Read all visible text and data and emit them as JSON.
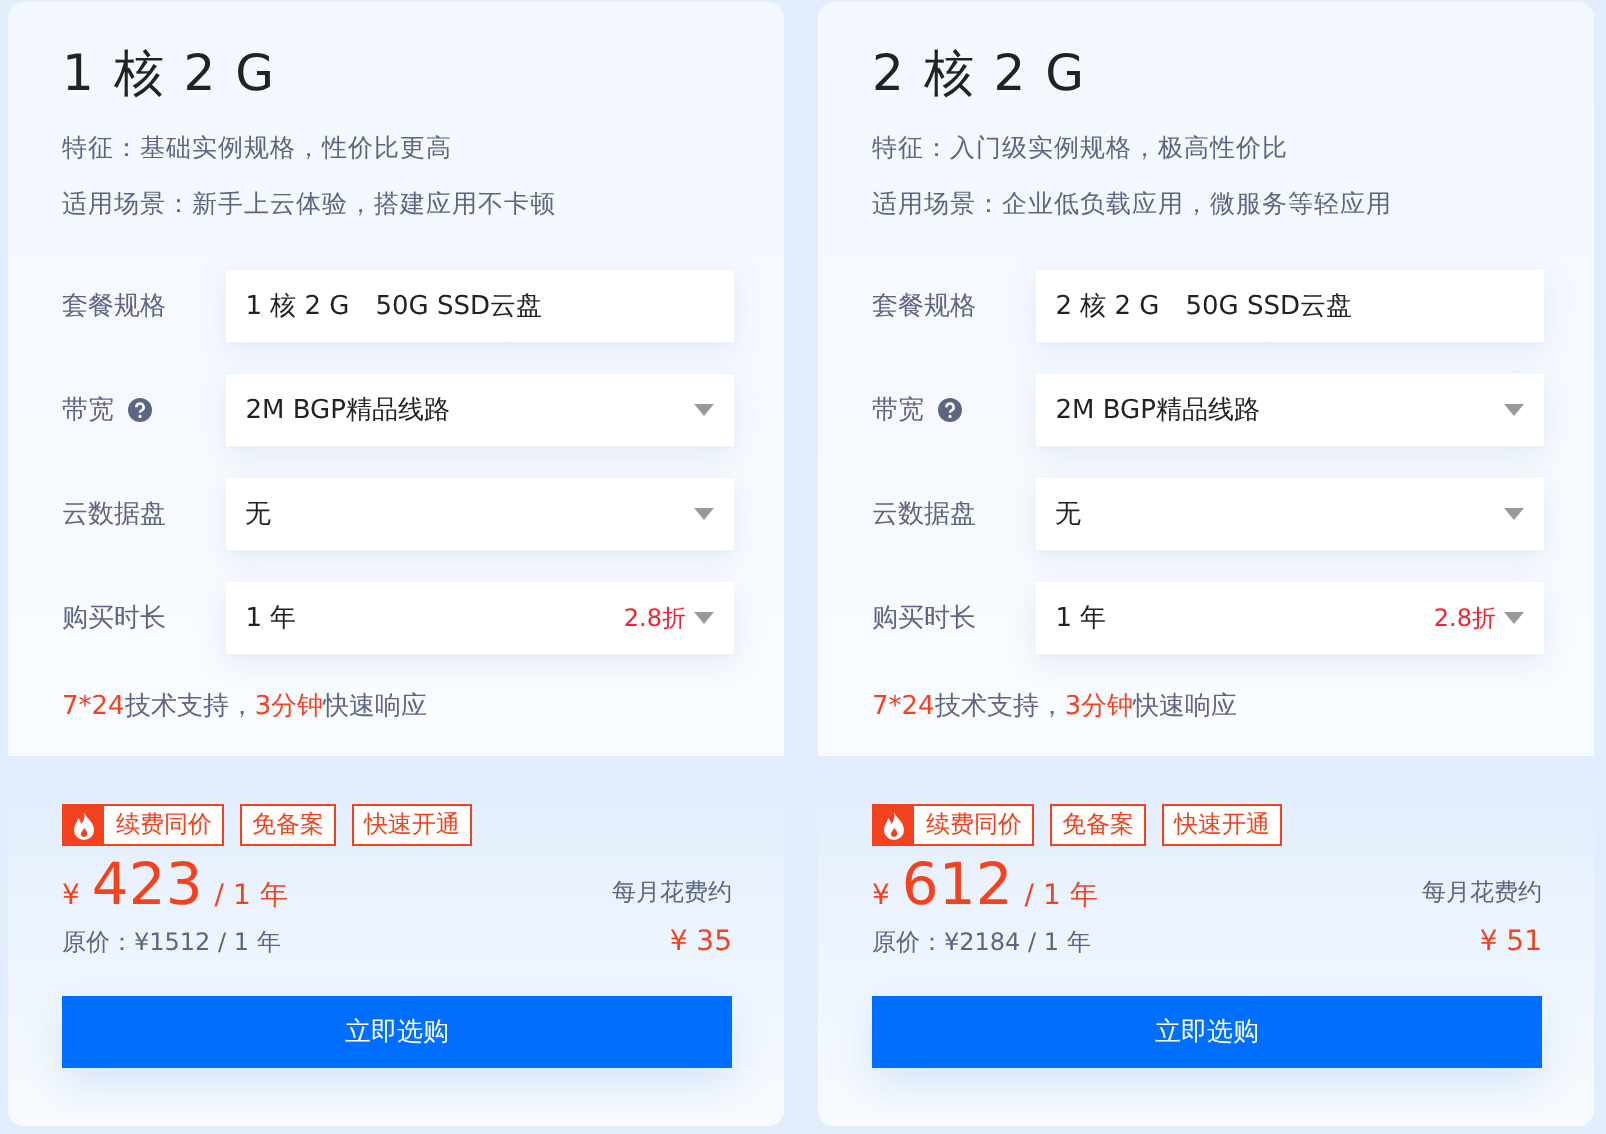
{
  "cards": [
    {
      "title": "1 核 2 G",
      "features": [
        "特征：基础实例规格，性价比更高",
        "适用场景：新手上云体验，搭建应用不卡顿"
      ],
      "options": [
        {
          "label": "套餐规格",
          "kind": "text",
          "help": false,
          "value": "1 核 2 G　50G SSD云盘"
        },
        {
          "label": "带宽",
          "kind": "select",
          "help": true,
          "value": "2M BGP精品线路"
        },
        {
          "label": "云数据盘",
          "kind": "select",
          "help": false,
          "value": "无"
        },
        {
          "label": "购买时长",
          "kind": "select",
          "help": false,
          "value": "1 年",
          "discount": "2.8折"
        }
      ],
      "support": [
        {
          "text": "7*24",
          "highlight": true
        },
        {
          "text": "技术支持，",
          "highlight": false
        },
        {
          "text": "3分钟",
          "highlight": true
        },
        {
          "text": "快速响应",
          "highlight": false
        }
      ],
      "tags": [
        {
          "kind": "hot",
          "label": "续费同价"
        },
        {
          "kind": "plain",
          "label": "免备案"
        },
        {
          "kind": "plain",
          "label": "快速开通"
        }
      ],
      "price": {
        "currency": "¥",
        "amount": "423",
        "period": "/ 1 年"
      },
      "original_price": "原价：¥1512 / 1 年",
      "monthly_label": "每月花费约",
      "monthly": "¥ 35",
      "button": "立即选购"
    },
    {
      "title": "2 核 2 G",
      "features": [
        "特征：入门级实例规格，极高性价比",
        "适用场景：企业低负载应用，微服务等轻应用"
      ],
      "options": [
        {
          "label": "套餐规格",
          "kind": "text",
          "help": false,
          "value": "2 核 2 G　50G SSD云盘"
        },
        {
          "label": "带宽",
          "kind": "select",
          "help": true,
          "value": "2M BGP精品线路"
        },
        {
          "label": "云数据盘",
          "kind": "select",
          "help": false,
          "value": "无"
        },
        {
          "label": "购买时长",
          "kind": "select",
          "help": false,
          "value": "1 年",
          "discount": "2.8折"
        }
      ],
      "support": [
        {
          "text": "7*24",
          "highlight": true
        },
        {
          "text": "技术支持，",
          "highlight": false
        },
        {
          "text": "3分钟",
          "highlight": true
        },
        {
          "text": "快速响应",
          "highlight": false
        }
      ],
      "tags": [
        {
          "kind": "hot",
          "label": "续费同价"
        },
        {
          "kind": "plain",
          "label": "免备案"
        },
        {
          "kind": "plain",
          "label": "快速开通"
        }
      ],
      "price": {
        "currency": "¥",
        "amount": "612",
        "period": "/ 1 年"
      },
      "original_price": "原价：¥2184 / 1 年",
      "monthly_label": "每月花费约",
      "monthly": "¥ 51",
      "button": "立即选购"
    }
  ]
}
